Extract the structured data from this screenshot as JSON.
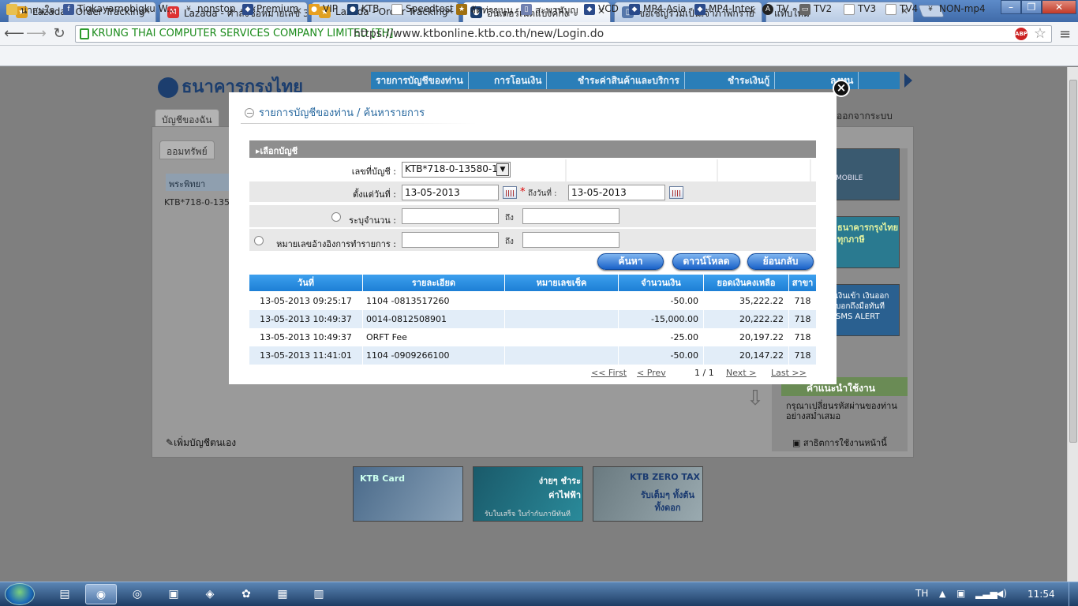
{
  "browser": {
    "tabs": [
      {
        "title": "Lazada - Order Tracking",
        "active": false
      },
      {
        "title": "Lazada - คำสั่งซื้อหมายเลข 3",
        "active": false
      },
      {
        "title": "Lazada - Order Tracking",
        "active": false
      },
      {
        "title": "อินเตอร์เน็ตแบงค์กิ้ง",
        "active": true
      },
      {
        "title": "ขอเชิญร่วมเป็นเจ้าภาพกราย",
        "active": false
      },
      {
        "title": "แท็บใหม่",
        "active": false
      }
    ],
    "window_controls": [
      "–",
      "❐",
      "✕"
    ],
    "ev_cert": "KRUNG THAI COMPUTER SERVICES COMPANY LIMITED [TH]",
    "url": "https://www.ktbonline.ktb.co.th/new/Login.do",
    "abp": "ABP",
    "bookmarks": [
      "น่าสนใจ",
      "Tigkayarnobigku W...",
      "nonstop",
      "Premium",
      "VIP",
      "KTB",
      "Speedtest",
      "จัดท่าขนุน",
      "สะพานบุญ",
      "VCD",
      "MP4-Asia",
      "MP4-Inter",
      "TV",
      "TV2",
      "TV3",
      "TV4",
      "NON-mp4"
    ]
  },
  "site": {
    "logo": "ธนาคารกรุงไทย",
    "menu": [
      "รายการบัญชีของท่าน",
      "การโอนเงิน",
      "ชำระค่าสินค้าและบริการ",
      "ชำระเงินกู้",
      "ลงทุน"
    ],
    "tab_my_accounts": "บัญชีของฉัน",
    "tab_savings": "ออมทรัพย์",
    "logout": "ออกจากระบบ",
    "bg_header": "พระพิทยา",
    "bg_account": "KTB*718-0-1358",
    "add_account": "เพิ่มบัญชีตนเอง",
    "tip_title": "คำแนะนำใช้งาน",
    "tip_text": "กรุณาเปลี่ยนรหัสผ่านของท่านอย่างสม่ำเสมอ",
    "manual": "สาธิตการใช้งานหน้านี้",
    "right_banners": [
      "MOBILE",
      "ธนาคารกรุงไทย ทุกภาษี",
      "เงินเข้า เงินออก บอกถึงมือทันที SMS ALERT"
    ],
    "banners": [
      {
        "title": "KTB Card",
        "sub": ""
      },
      {
        "title": "ง่ายๆ ชำระค่าไฟฟ้า",
        "sub": "รับใบเสร็จ ใบกำกับภาษีทันที"
      },
      {
        "title": "KTB ZERO TAX",
        "sub": "รับเต็มๆ ทั้งต้นทั้งดอก"
      }
    ]
  },
  "modal": {
    "close": "×",
    "title": "รายการบัญชีของท่าน / ค้นหารายการ",
    "section": "เลือกบัญชี",
    "account_label": "เลขที่บัญชี :",
    "account_value": "KTB*718-0-13580-1",
    "from_label": "ตั้งแต่วันที่ :",
    "from_value": "13-05-2013",
    "to_label": "ถึงวันที่ :",
    "to_value": "13-05-2013",
    "required_mark": "*",
    "amount_label": "ระบุจำนวน :",
    "ref_label": "หมายเลขอ้างอิงการทำรายการ :",
    "to_short": "ถึง",
    "buttons": {
      "search": "ค้นหา",
      "download": "ดาวน์โหลด",
      "back": "ย้อนกลับ"
    },
    "columns": [
      "วันที่",
      "รายละเอียด",
      "หมายเลขเช็ค",
      "จำนวนเงิน",
      "ยอดเงินคงเหลือ",
      "สาขา"
    ],
    "rows": [
      {
        "date": "13-05-2013 09:25:17",
        "detail": "1104 -0813517260",
        "cheque": "",
        "amount": "-50.00",
        "balance": "35,222.22",
        "branch": "718"
      },
      {
        "date": "13-05-2013 10:49:37",
        "detail": "0014-0812508901",
        "cheque": "",
        "amount": "-15,000.00",
        "balance": "20,222.22",
        "branch": "718"
      },
      {
        "date": "13-05-2013 10:49:37",
        "detail": "ORFT Fee",
        "cheque": "",
        "amount": "-25.00",
        "balance": "20,197.22",
        "branch": "718"
      },
      {
        "date": "13-05-2013 11:41:01",
        "detail": "1104 -0909266100",
        "cheque": "",
        "amount": "-50.00",
        "balance": "20,147.22",
        "branch": "718"
      }
    ],
    "pager": {
      "first": "<< First",
      "prev": "< Prev",
      "page": "1 / 1",
      "next": "Next >",
      "last": "Last >>"
    }
  },
  "taskbar": {
    "lang": "TH",
    "time": "11:54"
  },
  "colors": {
    "ktb_blue": "#1d7fd5",
    "header_gray": "#8e8e8e",
    "row_alt": "#e2edf8"
  }
}
